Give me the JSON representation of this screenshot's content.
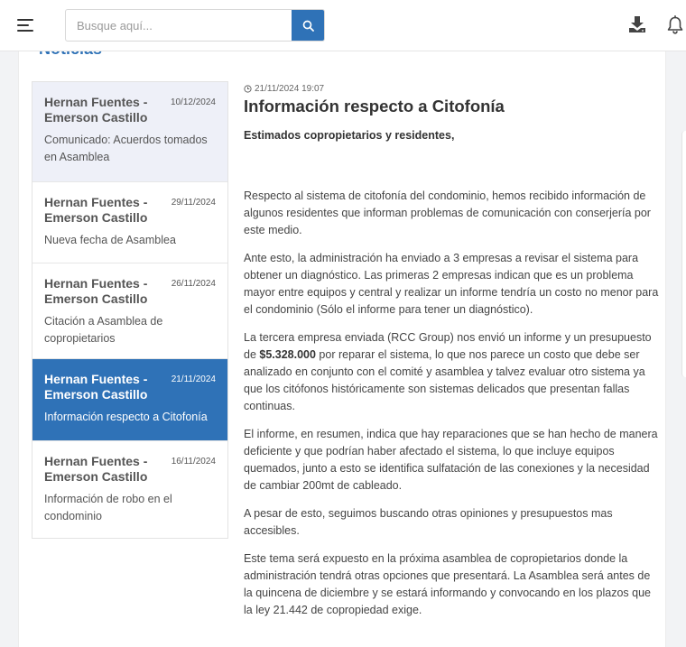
{
  "search": {
    "placeholder": "Busque aquí..."
  },
  "panel": {
    "title": "Noticias"
  },
  "news_list": [
    {
      "author": "Hernan Fuentes - Emerson Castillo",
      "date": "10/12/2024",
      "subject": "Comunicado: Acuerdos tomados en Asamblea"
    },
    {
      "author": "Hernan Fuentes - Emerson Castillo",
      "date": "29/11/2024",
      "subject": "Nueva fecha de Asamblea"
    },
    {
      "author": "Hernan Fuentes - Emerson Castillo",
      "date": "26/11/2024",
      "subject": "Citación a Asamblea de copropietarios"
    },
    {
      "author": "Hernan Fuentes - Emerson Castillo",
      "date": "21/11/2024",
      "subject": "Información respecto a Citofonía"
    },
    {
      "author": "Hernan Fuentes - Emerson Castillo",
      "date": "16/11/2024",
      "subject": "Información de robo en el condominio"
    }
  ],
  "article": {
    "timestamp": "21/11/2024 19:07",
    "title": "Información respecto a Citofonía",
    "greeting": "Estimados copropietarios y residentes,",
    "p1": "Respecto al sistema de citofonía del condominio, hemos recibido información de algunos residentes que informan problemas de comunicación con conserjería por este medio.",
    "p2": "Ante esto, la administración ha enviado a 3 empresas a revisar el sistema para obtener un diagnóstico. Las primeras 2 empresas indican que es un problema mayor entre equipos y central y realizar un informe tendría un costo no menor para el condominio (Sólo el informe para tener un diagnóstico).",
    "p3_before": "La tercera empresa enviada (RCC Group) nos envió un informe y un presupuesto de ",
    "p3_amount": "$5.328.000",
    "p3_after": " por reparar el sistema, lo que nos parece un costo que debe ser analizado en conjunto con el comité y asamblea y talvez evaluar otro sistema ya que los citófonos históricamente son sistemas delicados que presentan fallas continuas.",
    "p4": "El informe, en resumen, indica que hay reparaciones que se han hecho de manera deficiente y que podrían haber afectado el sistema, lo que incluye equipos quemados, junto a esto se identifica sulfatación de las conexiones y la necesidad de cambiar 200mt de cableado.",
    "p5": "A pesar de esto, seguimos buscando otras opiniones y presupuestos mas accesibles.",
    "p6": "Este tema será expuesto en la próxima asamblea de copropietarios donde la administración tendrá otras opciones que presentará. La Asamblea será antes de la quincena de diciembre y se estará informando y convocando en los plazos que la ley 21.442 de copropiedad exige."
  }
}
